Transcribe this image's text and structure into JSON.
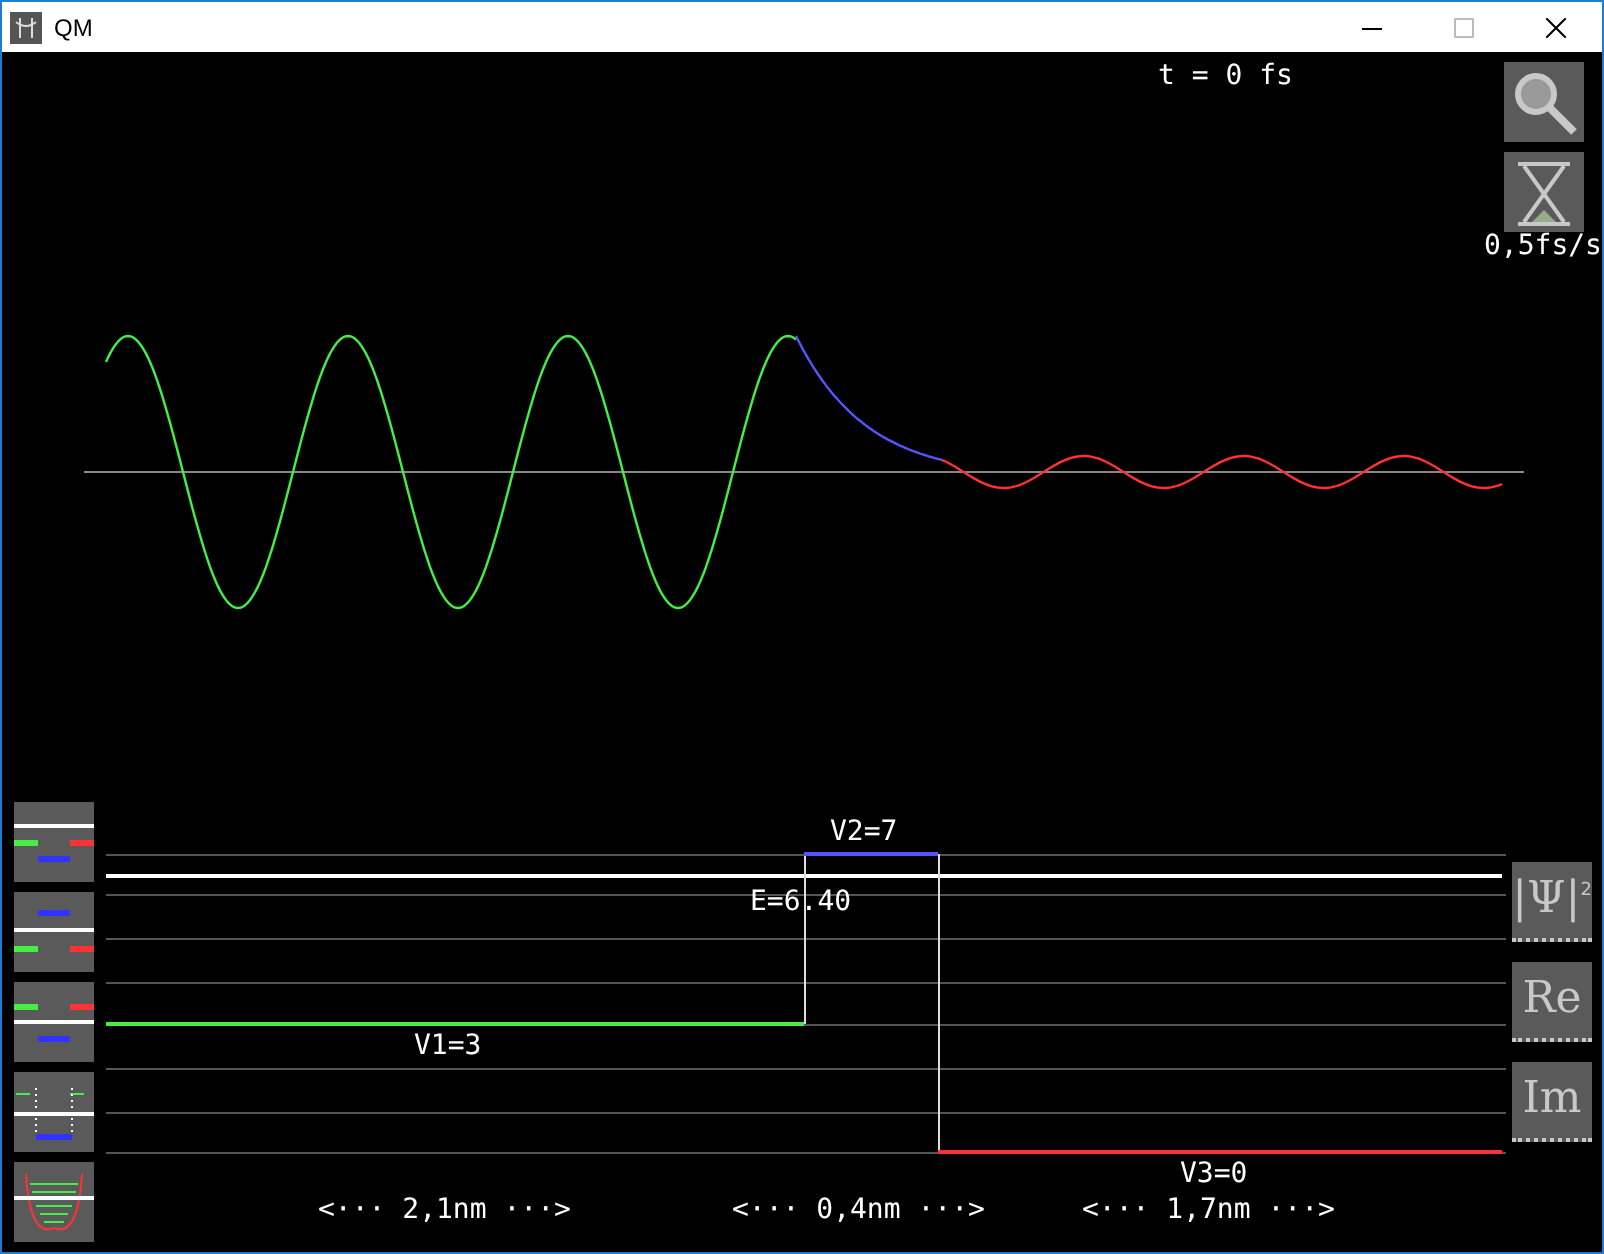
{
  "window": {
    "title": "QM"
  },
  "time_label": "t = 0 fs",
  "speed_label": "0,5fs/s",
  "energy_label": "E=6.40",
  "potential_labels": [
    {
      "text": "V1=3",
      "kind": "left"
    },
    {
      "text": "V2=7",
      "kind": "barrier"
    },
    {
      "text": "V3=0",
      "kind": "right"
    }
  ],
  "width_labels": [
    "<··· 2,1nm ···>",
    "<··· 0,4nm ···>",
    "<··· 1,7nm ···>"
  ],
  "view_buttons": [
    "|Ψ|$^{2}$",
    "Re",
    "Im"
  ]
}
